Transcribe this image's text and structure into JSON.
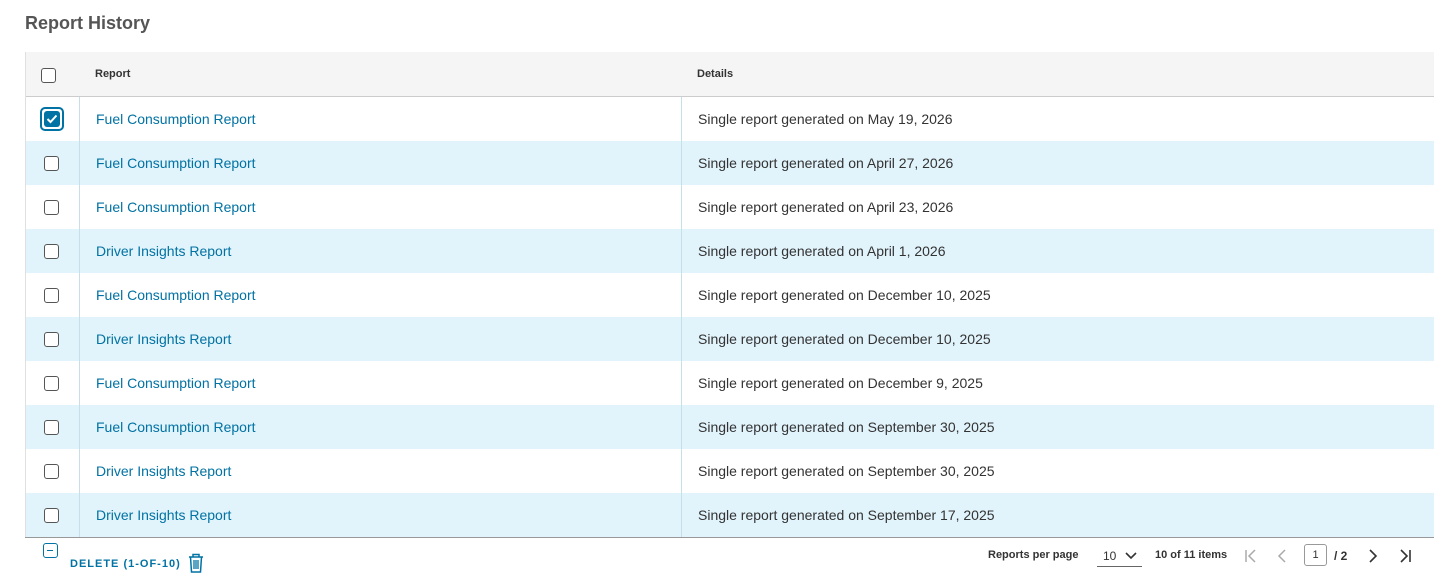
{
  "page": {
    "title": "Report History"
  },
  "table": {
    "columns": {
      "report": "Report",
      "details": "Details"
    },
    "rows": [
      {
        "report": "Fuel Consumption Report",
        "details": "Single report generated on May 19, 2026",
        "selected": true
      },
      {
        "report": "Fuel Consumption Report",
        "details": "Single report generated on April 27, 2026",
        "selected": false
      },
      {
        "report": "Fuel Consumption Report",
        "details": "Single report generated on April 23, 2026",
        "selected": false
      },
      {
        "report": "Driver Insights Report",
        "details": "Single report generated on April 1, 2026",
        "selected": false
      },
      {
        "report": "Fuel Consumption Report",
        "details": "Single report generated on December 10, 2025",
        "selected": false
      },
      {
        "report": "Driver Insights Report",
        "details": "Single report generated on December 10, 2025",
        "selected": false
      },
      {
        "report": "Fuel Consumption Report",
        "details": "Single report generated on December 9, 2025",
        "selected": false
      },
      {
        "report": "Fuel Consumption Report",
        "details": "Single report generated on September 30, 2025",
        "selected": false
      },
      {
        "report": "Driver Insights Report",
        "details": "Single report generated on September 30, 2025",
        "selected": false
      },
      {
        "report": "Driver Insights Report",
        "details": "Single report generated on September 17, 2025",
        "selected": false
      }
    ]
  },
  "footer": {
    "delete_label": "DELETE (1-OF-10)",
    "per_page_label": "Reports per page",
    "per_page_value": "10",
    "items_summary": "10 of 11 items",
    "current_page": "1",
    "page_separator": "/ 2"
  },
  "icons": {
    "collapse": "minus-square-icon",
    "delete": "trash-icon",
    "first": "first-page-icon",
    "prev": "chevron-left-icon",
    "next": "chevron-right-icon",
    "last": "last-page-icon",
    "dropdown": "chevron-down-icon"
  },
  "colors": {
    "link": "#0072a3",
    "row_alt": "#e1f3fb",
    "header_bg": "#f5f5f5"
  }
}
